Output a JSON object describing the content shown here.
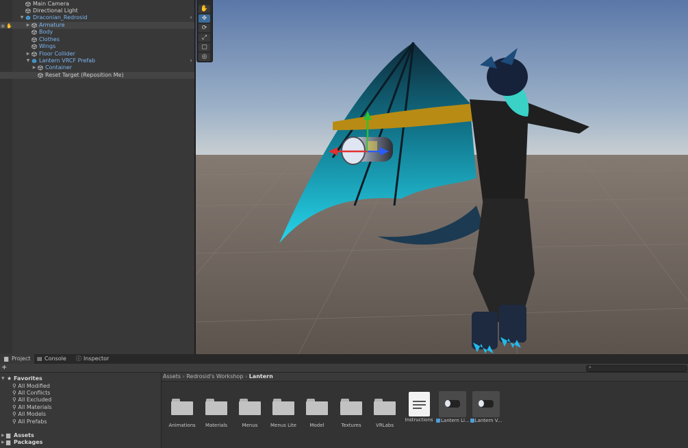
{
  "hierarchy": {
    "items": [
      {
        "label": "Main Camera"
      },
      {
        "label": "Directional Light"
      },
      {
        "label": "Draconian_Redrosid"
      },
      {
        "label": "Armature"
      },
      {
        "label": "Body"
      },
      {
        "label": "Clothes"
      },
      {
        "label": "Wings"
      },
      {
        "label": "Floor Collider"
      },
      {
        "label": "Lantern VRCF Prefab"
      },
      {
        "label": "Container"
      },
      {
        "label": "Reset Target (Reposition Me)"
      }
    ]
  },
  "scene": {
    "tools": [
      "hand-tool",
      "move-tool",
      "rotate-tool",
      "scale-tool",
      "rect-tool",
      "transform-tool"
    ]
  },
  "panel": {
    "tabs": [
      {
        "label": "Project"
      },
      {
        "label": "Console"
      },
      {
        "label": "Inspector"
      }
    ],
    "add_label": "+ ▾",
    "favorites": {
      "title": "Favorites",
      "items": [
        "All Modified",
        "All Conflicts",
        "All Excluded",
        "All Materials",
        "All Models",
        "All Prefabs"
      ]
    },
    "roots": [
      "Assets",
      "Packages"
    ],
    "breadcrumb": [
      "Assets",
      "Redrosid's Workshop",
      "Lantern"
    ],
    "assets": [
      {
        "label": "Animations",
        "kind": "folder"
      },
      {
        "label": "Materials",
        "kind": "folder"
      },
      {
        "label": "Menus",
        "kind": "folder"
      },
      {
        "label": "Menus Lite",
        "kind": "folder"
      },
      {
        "label": "Model",
        "kind": "folder"
      },
      {
        "label": "Textures",
        "kind": "folder"
      },
      {
        "label": "VRLabs",
        "kind": "folder"
      },
      {
        "label": "Instructions",
        "kind": "text"
      },
      {
        "label": "Lantern Li...",
        "kind": "prefab"
      },
      {
        "label": "Lantern V...",
        "kind": "prefab"
      }
    ]
  },
  "colors": {
    "selection_blue": "#7cb6f2",
    "active_tool": "#3d6c9c",
    "gizmo_x": "#e03030",
    "gizmo_y": "#30c030",
    "gizmo_z": "#2a5cff"
  }
}
